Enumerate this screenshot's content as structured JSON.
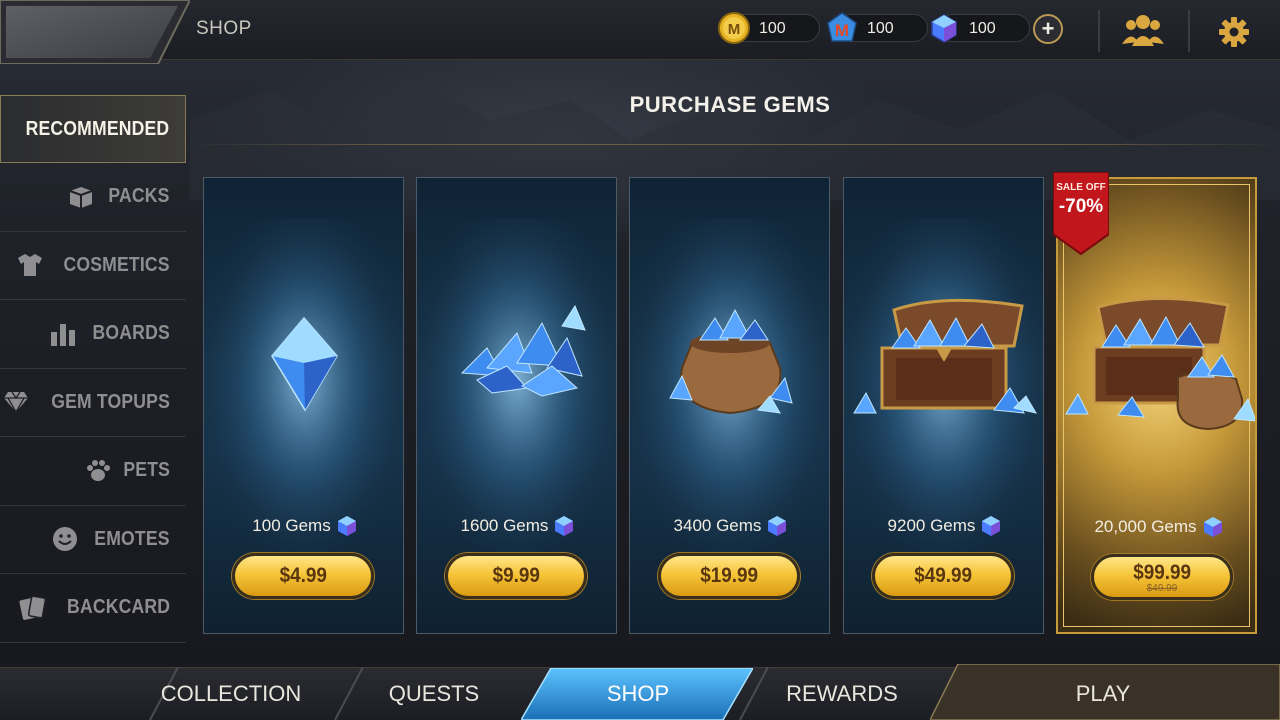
{
  "header": {
    "breadcrumb": "SHOP",
    "currencies": [
      {
        "name": "gold-coin",
        "value": "100",
        "color": "#e6b422"
      },
      {
        "name": "m-token",
        "value": "100",
        "color": "#e24a2a"
      },
      {
        "name": "gem",
        "value": "100",
        "color": "#4b7bff"
      }
    ]
  },
  "sidebar": {
    "items": [
      {
        "label": "RECOMMENDED",
        "icon": "bar-chart-icon",
        "active": true
      },
      {
        "label": "PACKS",
        "icon": "box-icon"
      },
      {
        "label": "COSMETICS",
        "icon": "shirt-icon"
      },
      {
        "label": "BOARDS",
        "icon": "bars-icon"
      },
      {
        "label": "GEM TOPUPS",
        "icon": "diamond-icon"
      },
      {
        "label": "PETS",
        "icon": "paw-icon"
      },
      {
        "label": "EMOTES",
        "icon": "smiley-icon"
      },
      {
        "label": "BACKCARD",
        "icon": "cards-icon"
      }
    ]
  },
  "main": {
    "title": "PURCHASE GEMS",
    "offers": [
      {
        "amount": "100 Gems",
        "price": "$4.99",
        "art": "single-gem"
      },
      {
        "amount": "1600 Gems",
        "price": "$9.99",
        "art": "gem-pile"
      },
      {
        "amount": "3400 Gems",
        "price": "$19.99",
        "art": "gem-sack"
      },
      {
        "amount": "9200 Gems",
        "price": "$49.99",
        "art": "gem-chest"
      },
      {
        "amount": "20,000 Gems",
        "price": "$99.99",
        "old_price": "$49.99",
        "art": "gem-chest-and-sack",
        "featured": true,
        "badge_top": "SALE OFF",
        "badge_discount": "-70%"
      }
    ]
  },
  "bottom_nav": {
    "tabs": [
      {
        "label": "COLLECTION"
      },
      {
        "label": "QUESTS"
      },
      {
        "label": "SHOP",
        "active": true
      },
      {
        "label": "REWARDS"
      },
      {
        "label": "PLAY"
      }
    ]
  },
  "colors": {
    "accent_gold": "#f6c53a",
    "active_tab_blue": "#2f8fd6",
    "card_blue": "#163248",
    "sale_red": "#c0161c"
  }
}
